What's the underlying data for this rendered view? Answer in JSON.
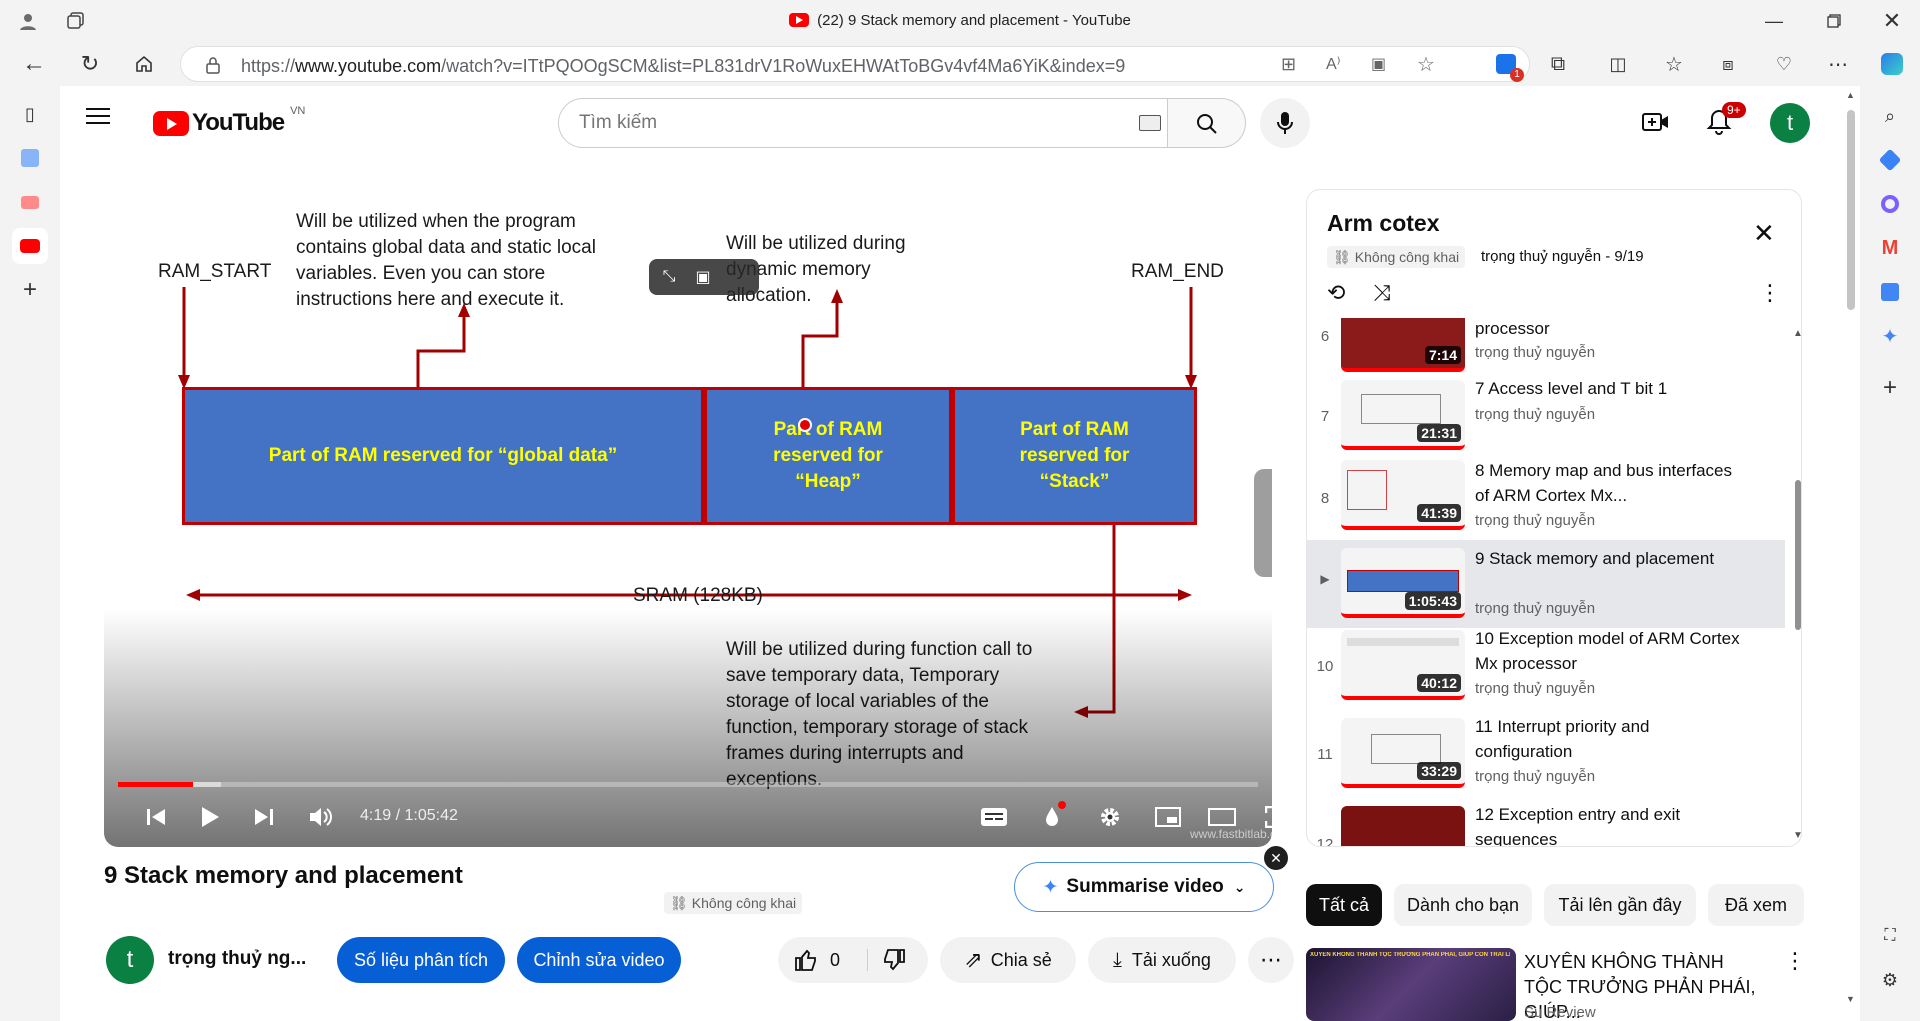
{
  "browser": {
    "tab_title": "(22) 9 Stack memory and placement - YouTube",
    "url_prefix": "https://",
    "url_host": "www.youtube.com",
    "url_path": "/watch?v=ITtPQOOgSCM&list=PL831drV1RoWuxEHWAtToBGv4vf4Ma6YiK&index=9",
    "extension_badge": "1"
  },
  "header": {
    "logo_text": "YouTube",
    "country": "VN",
    "search_placeholder": "Tìm kiếm",
    "notif_badge": "9+",
    "avatar_letter": "t"
  },
  "slide": {
    "ram_start": "RAM_START",
    "ram_end": "RAM_END",
    "note_global": "Will be utilized when the program contains global data and static local variables. Even you can store instructions here and execute it.",
    "note_heap": "Will be utilized during dynamic memory allocation.",
    "box_global": "Part of RAM reserved for “global data”",
    "box_heap": "Part of RAM reserved for “Heap”",
    "box_stack": "Part of RAM reserved for “Stack”",
    "sram_label": "SRAM (128KB)",
    "note_stack": "Will be utilized during function call to save temporary data, Temporary storage of local variables of the function, temporary storage of stack frames during interrupts and exceptions.",
    "watermark": "www.fastbitlab.com"
  },
  "player": {
    "time": "4:19 / 1:05:42",
    "progress": 0.066,
    "buffered": 0.09
  },
  "video": {
    "title": "9 Stack memory and placement",
    "visibility": "Không công khai",
    "summarise_label": "Summarise video",
    "channel_name": "trọng thuỷ ng...",
    "channel_avatar": "t",
    "analytics_label": "Số liệu phân tích",
    "edit_label": "Chỉnh sửa video",
    "like_count": "0",
    "share_label": "Chia sẻ",
    "download_label": "Tải xuống"
  },
  "playlist": {
    "title": "Arm cotex",
    "visibility": "Không công khai",
    "owner_position": "trọng thuỷ nguyễn - 9/19",
    "items": [
      {
        "num": "6",
        "title": "processor",
        "channel": "trọng thuỷ nguyễn",
        "duration": "7:14"
      },
      {
        "num": "7",
        "title": "7 Access level and T bit 1",
        "channel": "trọng thuỷ nguyễn",
        "duration": "21:31"
      },
      {
        "num": "8",
        "title": "8 Memory map and bus interfaces of ARM Cortex Mx...",
        "channel": "trọng thuỷ nguyễn",
        "duration": "41:39"
      },
      {
        "num": "▶",
        "title": "9 Stack memory and placement",
        "channel": "trọng thuỷ nguyễn",
        "duration": "1:05:43"
      },
      {
        "num": "10",
        "title": "10 Exception model of ARM Cortex Mx processor",
        "channel": "trọng thuỷ nguyễn",
        "duration": "40:12"
      },
      {
        "num": "11",
        "title": "11 Interrupt priority and configuration",
        "channel": "trọng thuỷ nguyễn",
        "duration": "33:29"
      },
      {
        "num": "12",
        "title": "12 Exception entry and exit sequences",
        "channel": "",
        "duration": ""
      }
    ]
  },
  "chips": [
    "Tất cả",
    "Dành cho bạn",
    "Tải lên gần đây",
    "Đã xem"
  ],
  "recommendation": {
    "title": "XUYÊN KHÔNG THÀNH TỘC TRƯỞNG PHẢN PHÁI, GIÚP...",
    "channel": "Su Review",
    "thumb_text": "XUYÊN KHÔNG THÀNH TỘC TRƯỞNG PHẢN PHÁI, GIÚP CON TRAI LIÊN CẢI TRẢ THÙ"
  }
}
